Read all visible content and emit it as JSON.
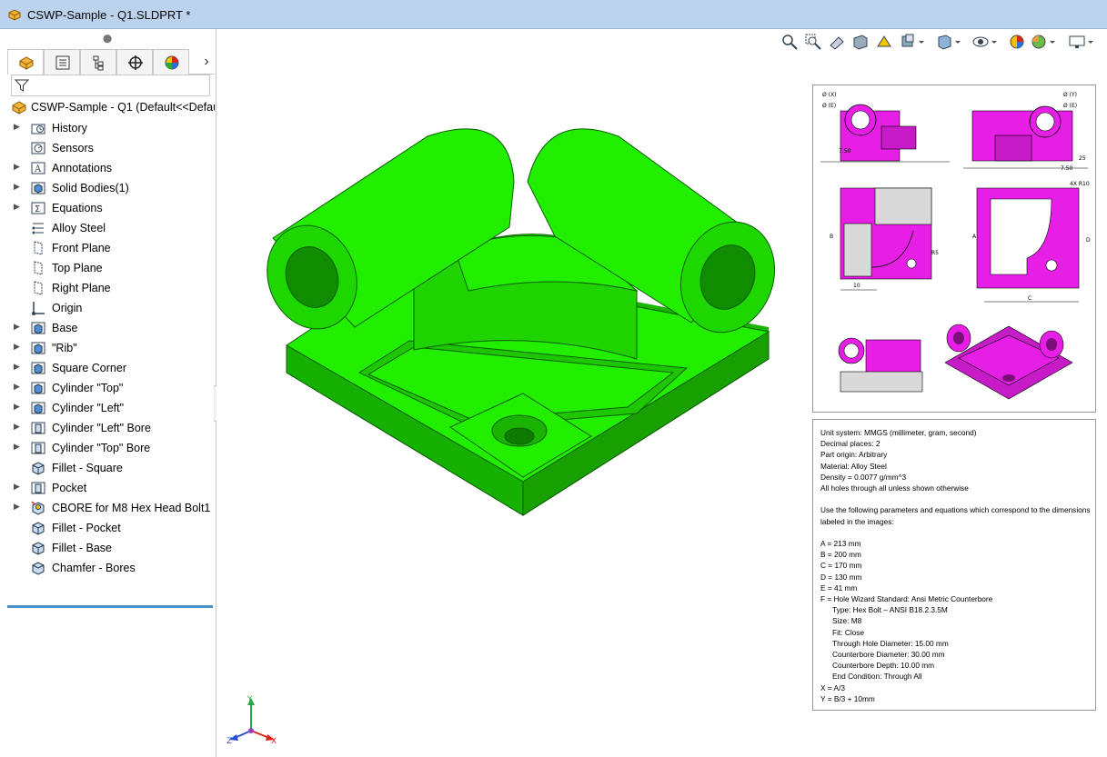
{
  "window": {
    "title": "CSWP-Sample - Q1.SLDPRT *"
  },
  "feature_tree": {
    "root_label": "CSWP-Sample - Q1  (Default<<Defaul",
    "items": [
      {
        "label": "History",
        "icon": "history-folder-icon",
        "expandable": true
      },
      {
        "label": "Sensors",
        "icon": "sensor-icon",
        "expandable": false
      },
      {
        "label": "Annotations",
        "icon": "annotations-icon",
        "expandable": true
      },
      {
        "label": "Solid Bodies(1)",
        "icon": "solid-bodies-icon",
        "expandable": true
      },
      {
        "label": "Equations",
        "icon": "equations-icon",
        "expandable": true
      },
      {
        "label": "Alloy Steel",
        "icon": "material-icon",
        "expandable": false
      },
      {
        "label": "Front Plane",
        "icon": "plane-icon",
        "expandable": false
      },
      {
        "label": "Top Plane",
        "icon": "plane-icon",
        "expandable": false
      },
      {
        "label": "Right Plane",
        "icon": "plane-icon",
        "expandable": false
      },
      {
        "label": "Origin",
        "icon": "origin-icon",
        "expandable": false
      },
      {
        "label": "Base",
        "icon": "extrude-icon",
        "expandable": true
      },
      {
        "label": "\"Rib\"",
        "icon": "extrude-icon",
        "expandable": true
      },
      {
        "label": "Square Corner",
        "icon": "extrude-icon",
        "expandable": true
      },
      {
        "label": "Cylinder \"Top\"",
        "icon": "extrude-icon",
        "expandable": true
      },
      {
        "label": "Cylinder \"Left\"",
        "icon": "extrude-icon",
        "expandable": true
      },
      {
        "label": "Cylinder \"Left\" Bore",
        "icon": "cut-extrude-icon",
        "expandable": true
      },
      {
        "label": "Cylinder \"Top\" Bore",
        "icon": "cut-extrude-icon",
        "expandable": true
      },
      {
        "label": "Fillet - Square",
        "icon": "fillet-icon",
        "expandable": false
      },
      {
        "label": "Pocket",
        "icon": "cut-extrude-icon",
        "expandable": true
      },
      {
        "label": "CBORE for M8 Hex Head Bolt1",
        "icon": "hole-wizard-icon",
        "expandable": true
      },
      {
        "label": "Fillet - Pocket",
        "icon": "fillet-icon",
        "expandable": false
      },
      {
        "label": "Fillet - Base",
        "icon": "fillet-icon",
        "expandable": false
      },
      {
        "label": "Chamfer - Bores",
        "icon": "chamfer-icon",
        "expandable": false
      }
    ]
  },
  "tabs": [
    "FeatureManager",
    "PropertyManager",
    "ConfigurationManager",
    "DimXpertManager",
    "DisplayManager"
  ],
  "colors": {
    "part": "#22ee00",
    "drawing_part": "#e61ee6",
    "titlebar": "#bcd3ee",
    "tree_end": "#4a90c9"
  },
  "info": {
    "lines": [
      {
        "text": "Unit system: MMGS (millimeter, gram, second)",
        "indent": false
      },
      {
        "text": "Decimal places: 2",
        "indent": false
      },
      {
        "text": "Part origin: Arbitrary",
        "indent": false
      },
      {
        "text": "Material: Alloy Steel",
        "indent": false
      },
      {
        "text": "Density = 0.0077 g/mm^3",
        "indent": false
      },
      {
        "text": "All holes through all unless shown otherwise",
        "indent": false
      },
      {
        "text": "",
        "indent": false
      },
      {
        "text": "Use the following parameters and equations which correspond to the dimensions",
        "indent": false
      },
      {
        "text": "labeled in the images:",
        "indent": false
      },
      {
        "text": "",
        "indent": false
      },
      {
        "text": "A = 213 mm",
        "indent": false
      },
      {
        "text": "B = 200 mm",
        "indent": false
      },
      {
        "text": "C = 170 mm",
        "indent": false
      },
      {
        "text": "D = 130 mm",
        "indent": false
      },
      {
        "text": "E = 41 mm",
        "indent": false
      },
      {
        "text": "F = Hole Wizard Standard: Ansi Metric Counterbore",
        "indent": false
      },
      {
        "text": "Type: Hex Bolt – ANSI B18.2.3.5M",
        "indent": true
      },
      {
        "text": "Size: M8",
        "indent": true
      },
      {
        "text": "Fit: Close",
        "indent": true
      },
      {
        "text": "Through Hole Diameter: 15.00 mm",
        "indent": true
      },
      {
        "text": "Counterbore Diameter:  30.00 mm",
        "indent": true
      },
      {
        "text": "Counterbore Depth: 10.00 mm",
        "indent": true
      },
      {
        "text": "End Condition: Through All",
        "indent": true
      },
      {
        "text": "X = A/3",
        "indent": false
      },
      {
        "text": "Y = B/3 + 10mm",
        "indent": false
      }
    ]
  },
  "drawing": {
    "labels": [
      "Ø (X)",
      "Ø (E)",
      "Ø (Y)",
      "Ø (E)",
      "7.50",
      "7.50",
      "25",
      "A",
      "B",
      "C",
      "D",
      "4X R10",
      "R5",
      "10"
    ]
  },
  "triad": {
    "x": "X",
    "y": "Y",
    "z": "Z"
  }
}
